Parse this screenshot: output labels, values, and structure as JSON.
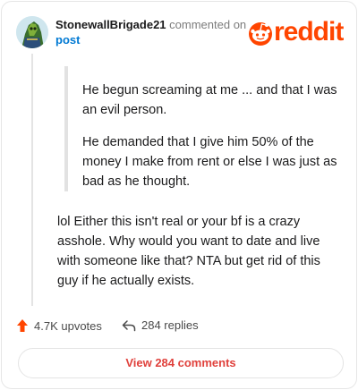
{
  "header": {
    "author": "StonewallBrigade21",
    "action": "commented on",
    "post_link": "post",
    "logo_text": "reddit"
  },
  "quote": {
    "paragraphs": [
      "He begun screaming at me ... and that I was an evil person.",
      "He demanded that I give him 50% of the money I make from rent or else I was just as bad as he thought."
    ]
  },
  "comment": {
    "text": "lol Either this isn't real or your bf is a crazy asshole. Why would you want to date and live with someone like that? NTA but get rid of this guy if he actually exists."
  },
  "stats": {
    "upvotes": "4.7K upvotes",
    "replies": "284 replies"
  },
  "footer": {
    "view_comments": "View 284 comments"
  },
  "colors": {
    "brand": "#ff4500",
    "link": "#0079d3",
    "button_text": "#e0413c"
  },
  "icons": {
    "upvote": "upvote-arrow-icon",
    "reply": "reply-arrow-icon",
    "logo": "reddit-snoo-icon"
  }
}
